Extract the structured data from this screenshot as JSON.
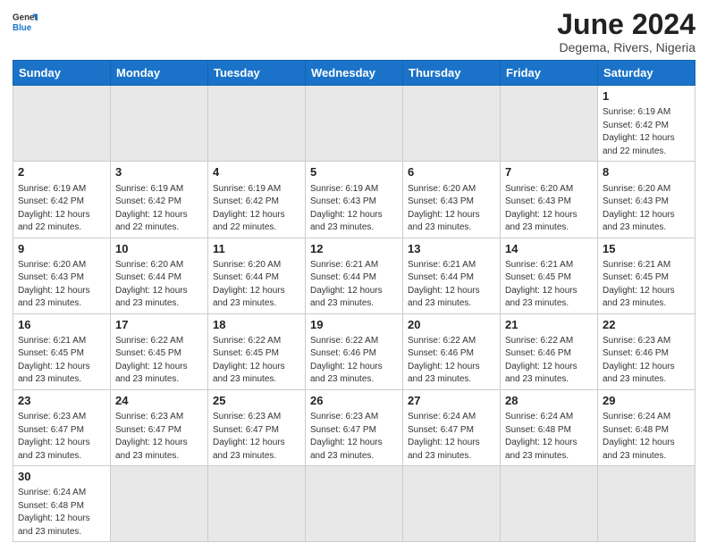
{
  "header": {
    "logo_line1": "General",
    "logo_line2": "Blue",
    "title": "June 2024",
    "location": "Degema, Rivers, Nigeria"
  },
  "weekdays": [
    "Sunday",
    "Monday",
    "Tuesday",
    "Wednesday",
    "Thursday",
    "Friday",
    "Saturday"
  ],
  "weeks": [
    [
      {
        "day": "",
        "info": ""
      },
      {
        "day": "",
        "info": ""
      },
      {
        "day": "",
        "info": ""
      },
      {
        "day": "",
        "info": ""
      },
      {
        "day": "",
        "info": ""
      },
      {
        "day": "",
        "info": ""
      },
      {
        "day": "1",
        "info": "Sunrise: 6:19 AM\nSunset: 6:42 PM\nDaylight: 12 hours\nand 22 minutes."
      }
    ],
    [
      {
        "day": "2",
        "info": "Sunrise: 6:19 AM\nSunset: 6:42 PM\nDaylight: 12 hours\nand 22 minutes."
      },
      {
        "day": "3",
        "info": "Sunrise: 6:19 AM\nSunset: 6:42 PM\nDaylight: 12 hours\nand 22 minutes."
      },
      {
        "day": "4",
        "info": "Sunrise: 6:19 AM\nSunset: 6:42 PM\nDaylight: 12 hours\nand 22 minutes."
      },
      {
        "day": "5",
        "info": "Sunrise: 6:19 AM\nSunset: 6:43 PM\nDaylight: 12 hours\nand 23 minutes."
      },
      {
        "day": "6",
        "info": "Sunrise: 6:20 AM\nSunset: 6:43 PM\nDaylight: 12 hours\nand 23 minutes."
      },
      {
        "day": "7",
        "info": "Sunrise: 6:20 AM\nSunset: 6:43 PM\nDaylight: 12 hours\nand 23 minutes."
      },
      {
        "day": "8",
        "info": "Sunrise: 6:20 AM\nSunset: 6:43 PM\nDaylight: 12 hours\nand 23 minutes."
      }
    ],
    [
      {
        "day": "9",
        "info": "Sunrise: 6:20 AM\nSunset: 6:43 PM\nDaylight: 12 hours\nand 23 minutes."
      },
      {
        "day": "10",
        "info": "Sunrise: 6:20 AM\nSunset: 6:44 PM\nDaylight: 12 hours\nand 23 minutes."
      },
      {
        "day": "11",
        "info": "Sunrise: 6:20 AM\nSunset: 6:44 PM\nDaylight: 12 hours\nand 23 minutes."
      },
      {
        "day": "12",
        "info": "Sunrise: 6:21 AM\nSunset: 6:44 PM\nDaylight: 12 hours\nand 23 minutes."
      },
      {
        "day": "13",
        "info": "Sunrise: 6:21 AM\nSunset: 6:44 PM\nDaylight: 12 hours\nand 23 minutes."
      },
      {
        "day": "14",
        "info": "Sunrise: 6:21 AM\nSunset: 6:45 PM\nDaylight: 12 hours\nand 23 minutes."
      },
      {
        "day": "15",
        "info": "Sunrise: 6:21 AM\nSunset: 6:45 PM\nDaylight: 12 hours\nand 23 minutes."
      }
    ],
    [
      {
        "day": "16",
        "info": "Sunrise: 6:21 AM\nSunset: 6:45 PM\nDaylight: 12 hours\nand 23 minutes."
      },
      {
        "day": "17",
        "info": "Sunrise: 6:22 AM\nSunset: 6:45 PM\nDaylight: 12 hours\nand 23 minutes."
      },
      {
        "day": "18",
        "info": "Sunrise: 6:22 AM\nSunset: 6:45 PM\nDaylight: 12 hours\nand 23 minutes."
      },
      {
        "day": "19",
        "info": "Sunrise: 6:22 AM\nSunset: 6:46 PM\nDaylight: 12 hours\nand 23 minutes."
      },
      {
        "day": "20",
        "info": "Sunrise: 6:22 AM\nSunset: 6:46 PM\nDaylight: 12 hours\nand 23 minutes."
      },
      {
        "day": "21",
        "info": "Sunrise: 6:22 AM\nSunset: 6:46 PM\nDaylight: 12 hours\nand 23 minutes."
      },
      {
        "day": "22",
        "info": "Sunrise: 6:23 AM\nSunset: 6:46 PM\nDaylight: 12 hours\nand 23 minutes."
      }
    ],
    [
      {
        "day": "23",
        "info": "Sunrise: 6:23 AM\nSunset: 6:47 PM\nDaylight: 12 hours\nand 23 minutes."
      },
      {
        "day": "24",
        "info": "Sunrise: 6:23 AM\nSunset: 6:47 PM\nDaylight: 12 hours\nand 23 minutes."
      },
      {
        "day": "25",
        "info": "Sunrise: 6:23 AM\nSunset: 6:47 PM\nDaylight: 12 hours\nand 23 minutes."
      },
      {
        "day": "26",
        "info": "Sunrise: 6:23 AM\nSunset: 6:47 PM\nDaylight: 12 hours\nand 23 minutes."
      },
      {
        "day": "27",
        "info": "Sunrise: 6:24 AM\nSunset: 6:47 PM\nDaylight: 12 hours\nand 23 minutes."
      },
      {
        "day": "28",
        "info": "Sunrise: 6:24 AM\nSunset: 6:48 PM\nDaylight: 12 hours\nand 23 minutes."
      },
      {
        "day": "29",
        "info": "Sunrise: 6:24 AM\nSunset: 6:48 PM\nDaylight: 12 hours\nand 23 minutes."
      }
    ],
    [
      {
        "day": "30",
        "info": "Sunrise: 6:24 AM\nSunset: 6:48 PM\nDaylight: 12 hours\nand 23 minutes."
      },
      {
        "day": "",
        "info": ""
      },
      {
        "day": "",
        "info": ""
      },
      {
        "day": "",
        "info": ""
      },
      {
        "day": "",
        "info": ""
      },
      {
        "day": "",
        "info": ""
      },
      {
        "day": "",
        "info": ""
      }
    ]
  ]
}
